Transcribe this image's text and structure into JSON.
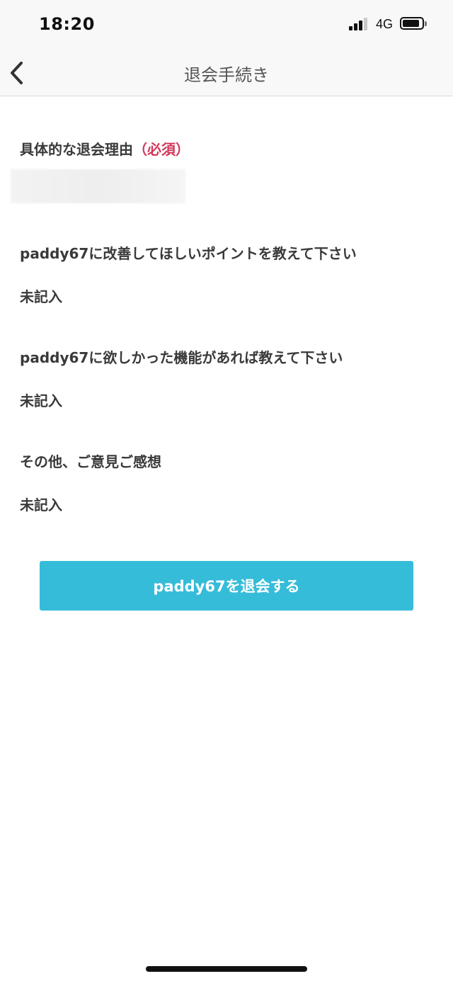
{
  "status_bar": {
    "time": "18:20",
    "network": "4G"
  },
  "nav": {
    "back_icon": "chevron-left-icon",
    "title": "退会手続き"
  },
  "form": {
    "reason_label": "具体的な退会理由",
    "reason_required": "（必須）",
    "improve_label": "paddy67に改善してほしいポイントを教えて下さい",
    "improve_value": "未記入",
    "features_label": "paddy67に欲しかった機能があれば教えて下さい",
    "features_value": "未記入",
    "other_label": "その他、ご意見ご感想",
    "other_value": "未記入"
  },
  "actions": {
    "withdraw_label": "paddy67を退会する"
  },
  "colors": {
    "accent": "#35bcd9",
    "required": "#d2375a"
  }
}
